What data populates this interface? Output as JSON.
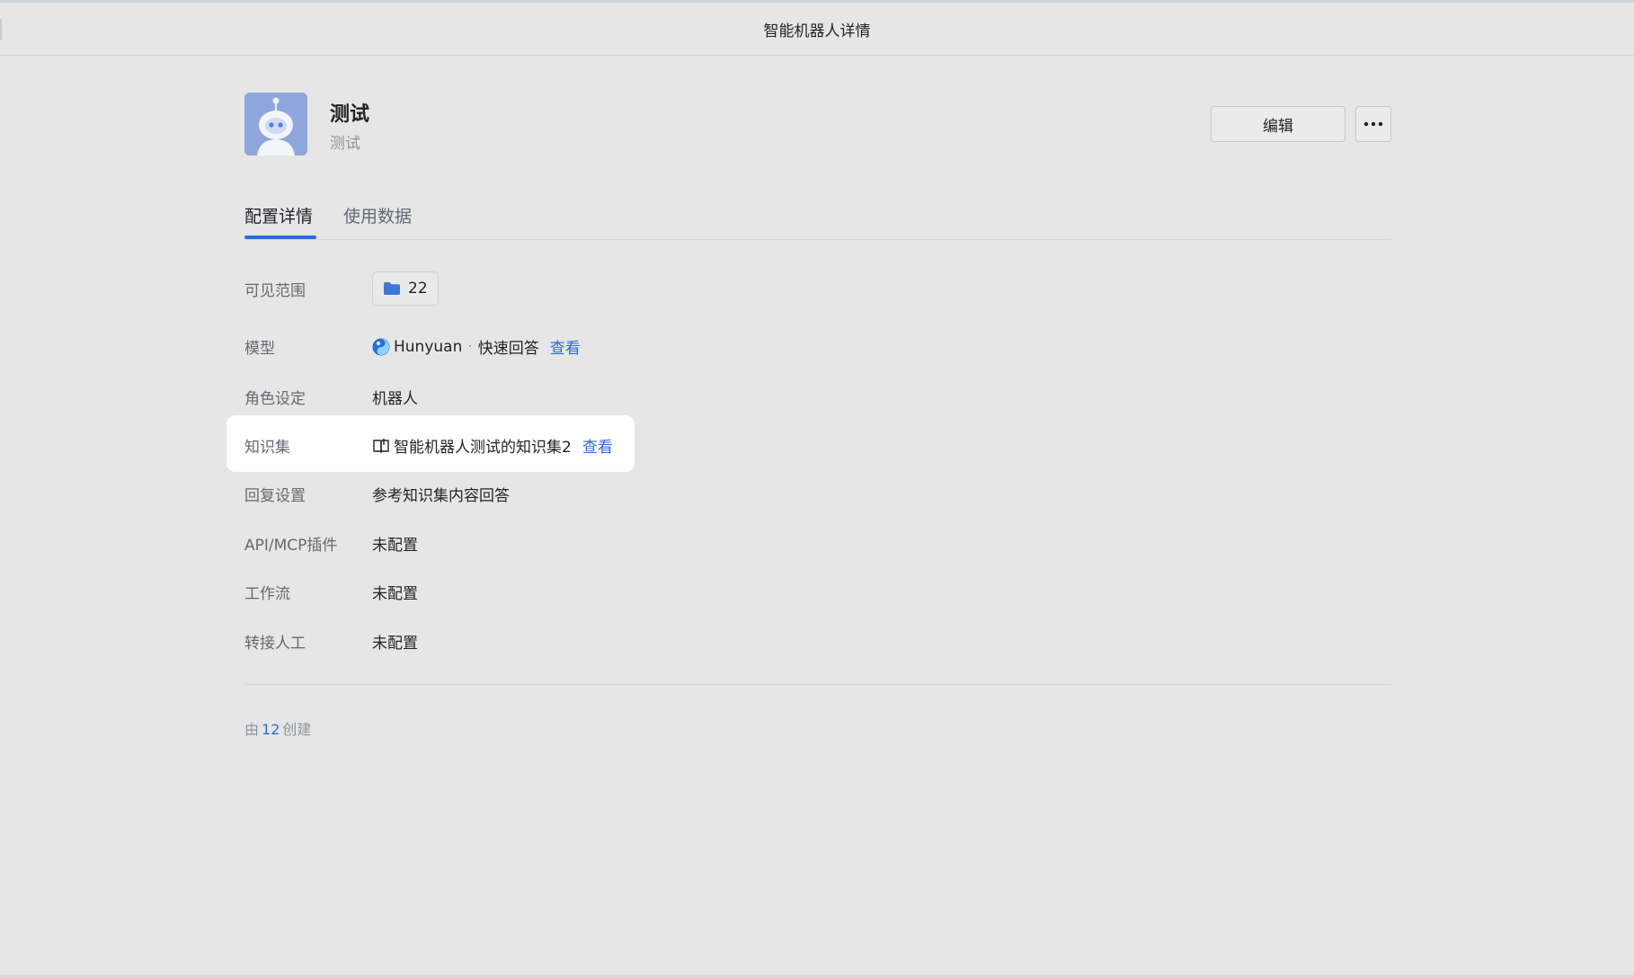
{
  "window": {
    "title": "智能机器人详情"
  },
  "bot": {
    "name": "测试",
    "description": "测试"
  },
  "actions": {
    "edit_label": "编辑",
    "more_label": "···"
  },
  "tabs": [
    {
      "label": "配置详情",
      "active": true
    },
    {
      "label": "使用数据",
      "active": false
    }
  ],
  "config": {
    "visibility": {
      "label": "可见范围",
      "value": "22",
      "icon": "folder-icon"
    },
    "model": {
      "label": "模型",
      "name": "Hunyuan",
      "separator": "·",
      "mode": "快速回答",
      "link": "查看",
      "icon": "hunyuan-logo-icon"
    },
    "role": {
      "label": "角色设定",
      "value": "机器人"
    },
    "knowledge": {
      "label": "知识集",
      "value": "智能机器人测试的知识集2",
      "link": "查看",
      "icon": "book-icon",
      "highlighted": true
    },
    "reply": {
      "label": "回复设置",
      "value": "参考知识集内容回答"
    },
    "plugins": {
      "label": "API/MCP插件",
      "value": "未配置"
    },
    "workflow": {
      "label": "工作流",
      "value": "未配置"
    },
    "handoff": {
      "label": "转接人工",
      "value": "未配置"
    }
  },
  "footer": {
    "prefix": "由",
    "creator": "12",
    "suffix": "创建"
  },
  "colors": {
    "accent": "#2d6bd6",
    "background": "#e6e6e6",
    "highlight": "#ffffff",
    "muted": "#8f959e"
  }
}
